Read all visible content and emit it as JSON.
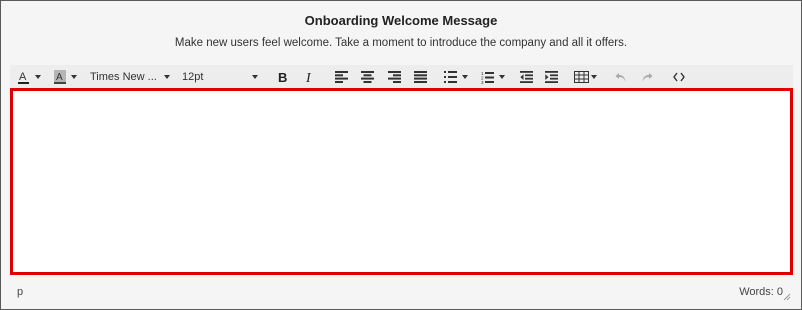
{
  "header": {
    "title": "Onboarding Welcome Message",
    "subtitle": "Make new users feel welcome. Take a moment to introduce the company and all it offers."
  },
  "toolbar": {
    "font_family": "Times New ...",
    "font_size": "12pt",
    "icons": [
      "text-color-icon",
      "background-color-icon",
      "bold-icon",
      "italic-icon",
      "align-left-icon",
      "align-center-icon",
      "align-right-icon",
      "justify-icon",
      "bullet-list-icon",
      "numbered-list-icon",
      "outdent-icon",
      "indent-icon",
      "table-icon",
      "undo-icon",
      "redo-icon",
      "source-code-icon"
    ]
  },
  "editor": {
    "content": ""
  },
  "statusbar": {
    "path": "p",
    "word_count": "Words: 0"
  },
  "colors": {
    "editor_border": "#e00000",
    "toolbar_bg": "#ededed",
    "frame_bg": "#f5f5f5"
  }
}
